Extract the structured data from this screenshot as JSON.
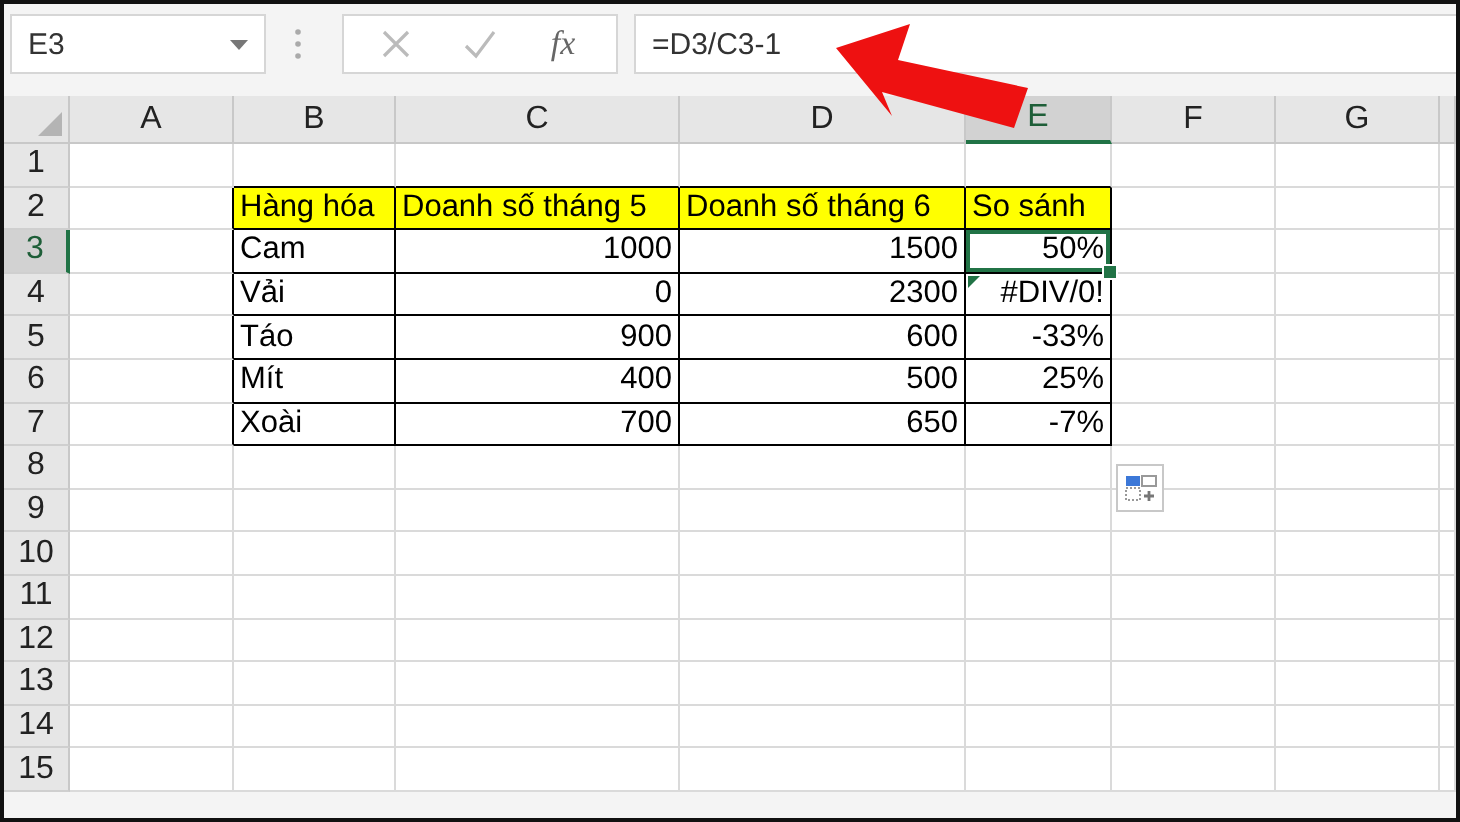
{
  "formula_bar": {
    "name_box": "E3",
    "function_label": "fx",
    "formula": "=D3/C3-1"
  },
  "columns": [
    {
      "letter": "A",
      "selected": false
    },
    {
      "letter": "B",
      "selected": false
    },
    {
      "letter": "C",
      "selected": false
    },
    {
      "letter": "D",
      "selected": false
    },
    {
      "letter": "E",
      "selected": true
    },
    {
      "letter": "F",
      "selected": false
    },
    {
      "letter": "G",
      "selected": false
    }
  ],
  "rows": [
    {
      "label": "1",
      "selected": false
    },
    {
      "label": "2",
      "selected": false
    },
    {
      "label": "3",
      "selected": true
    },
    {
      "label": "4",
      "selected": false
    },
    {
      "label": "5",
      "selected": false
    },
    {
      "label": "6",
      "selected": false
    },
    {
      "label": "7",
      "selected": false
    },
    {
      "label": "8",
      "selected": false
    },
    {
      "label": "9",
      "selected": false
    },
    {
      "label": "10",
      "selected": false
    },
    {
      "label": "11",
      "selected": false
    },
    {
      "label": "12",
      "selected": false
    },
    {
      "label": "13",
      "selected": false
    },
    {
      "label": "14",
      "selected": false
    },
    {
      "label": "15",
      "selected": false
    }
  ],
  "table": {
    "header": [
      "Hàng hóa",
      "Doanh số tháng 5",
      "Doanh số tháng 6",
      "So sánh"
    ],
    "rows": [
      {
        "cells": [
          {
            "text": "Cam",
            "selected": false,
            "error_flag": false
          },
          {
            "text": "1000",
            "selected": false,
            "error_flag": false
          },
          {
            "text": "1500",
            "selected": false,
            "error_flag": false
          },
          {
            "text": "50%",
            "selected": true,
            "error_flag": false
          }
        ]
      },
      {
        "cells": [
          {
            "text": "Vải",
            "selected": false,
            "error_flag": false
          },
          {
            "text": "0",
            "selected": false,
            "error_flag": false
          },
          {
            "text": "2300",
            "selected": false,
            "error_flag": false
          },
          {
            "text": "#DIV/0!",
            "selected": false,
            "error_flag": true
          }
        ]
      },
      {
        "cells": [
          {
            "text": "Táo",
            "selected": false,
            "error_flag": false
          },
          {
            "text": "900",
            "selected": false,
            "error_flag": false
          },
          {
            "text": "600",
            "selected": false,
            "error_flag": false
          },
          {
            "text": "-33%",
            "selected": false,
            "error_flag": false
          }
        ]
      },
      {
        "cells": [
          {
            "text": "Mít",
            "selected": false,
            "error_flag": false
          },
          {
            "text": "400",
            "selected": false,
            "error_flag": false
          },
          {
            "text": "500",
            "selected": false,
            "error_flag": false
          },
          {
            "text": "25%",
            "selected": false,
            "error_flag": false
          }
        ]
      },
      {
        "cells": [
          {
            "text": "Xoài",
            "selected": false,
            "error_flag": false
          },
          {
            "text": "700",
            "selected": false,
            "error_flag": false
          },
          {
            "text": "650",
            "selected": false,
            "error_flag": false
          },
          {
            "text": "-7%",
            "selected": false,
            "error_flag": false
          }
        ]
      }
    ]
  }
}
